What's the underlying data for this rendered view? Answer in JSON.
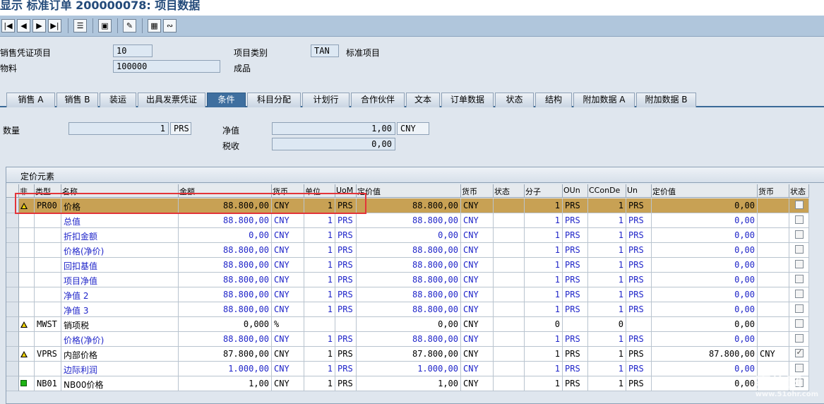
{
  "window": {
    "title": "显示 标准订单 200000078: 项目数据"
  },
  "toolbar": {
    "buttons": [
      "first-icon",
      "prev-icon",
      "next-icon",
      "last-icon",
      "document-flow-icon",
      "overview-icon",
      "edit-icon",
      "calculator-icon",
      "analysis-icon"
    ]
  },
  "header": {
    "item_label": "销售凭证项目",
    "item_value": "10",
    "category_label": "项目类别",
    "category_value": "TAN",
    "category_desc": "标准项目",
    "material_label": "物料",
    "material_value": "100000",
    "material_desc": "成品"
  },
  "tabs": [
    "销售 A",
    "销售 B",
    "装运",
    "出具发票凭证",
    "条件",
    "科目分配",
    "计划行",
    "合作伙伴",
    "文本",
    "订单数据",
    "状态",
    "结构",
    "附加数据 A",
    "附加数据 B"
  ],
  "active_tab": "条件",
  "summary": {
    "qty_label": "数量",
    "qty_value": "1",
    "qty_unit": "PRS",
    "net_label": "净值",
    "net_value": "1,00",
    "net_currency": "CNY",
    "tax_label": "税收",
    "tax_value": "0,00"
  },
  "pricing": {
    "title": "定价元素",
    "columns": [
      "非",
      "类型",
      "名称",
      "金额",
      "货币",
      "单位",
      "UoM",
      "定价值",
      "货币",
      "状态",
      "分子",
      "OUn",
      "CConDe",
      "Un",
      "定价值",
      "货币",
      "状态"
    ],
    "rows": [
      {
        "icon": "yellow",
        "type": "PR00",
        "name": "价格",
        "amount": "88.800,00",
        "curr": "CNY",
        "unit": "1",
        "uom": "PRS",
        "cval": "88.800,00",
        "ccurr": "CNY",
        "stat": "",
        "num": "1",
        "oun": "PRS",
        "ccon": "1",
        "un": "PRS",
        "cval2": "0,00",
        "ccurr2": "",
        "chk": false,
        "blue": false,
        "sel": true
      },
      {
        "icon": "",
        "type": "",
        "name": "总值",
        "amount": "88.800,00",
        "curr": "CNY",
        "unit": "1",
        "uom": "PRS",
        "cval": "88.800,00",
        "ccurr": "CNY",
        "stat": "",
        "num": "1",
        "oun": "PRS",
        "ccon": "1",
        "un": "PRS",
        "cval2": "0,00",
        "ccurr2": "",
        "chk": false,
        "blue": true,
        "sel": false
      },
      {
        "icon": "",
        "type": "",
        "name": "折扣金额",
        "amount": "0,00",
        "curr": "CNY",
        "unit": "1",
        "uom": "PRS",
        "cval": "0,00",
        "ccurr": "CNY",
        "stat": "",
        "num": "1",
        "oun": "PRS",
        "ccon": "1",
        "un": "PRS",
        "cval2": "0,00",
        "ccurr2": "",
        "chk": false,
        "blue": true,
        "sel": false
      },
      {
        "icon": "",
        "type": "",
        "name": "价格(净价)",
        "amount": "88.800,00",
        "curr": "CNY",
        "unit": "1",
        "uom": "PRS",
        "cval": "88.800,00",
        "ccurr": "CNY",
        "stat": "",
        "num": "1",
        "oun": "PRS",
        "ccon": "1",
        "un": "PRS",
        "cval2": "0,00",
        "ccurr2": "",
        "chk": false,
        "blue": true,
        "sel": false
      },
      {
        "icon": "",
        "type": "",
        "name": "回扣基值",
        "amount": "88.800,00",
        "curr": "CNY",
        "unit": "1",
        "uom": "PRS",
        "cval": "88.800,00",
        "ccurr": "CNY",
        "stat": "",
        "num": "1",
        "oun": "PRS",
        "ccon": "1",
        "un": "PRS",
        "cval2": "0,00",
        "ccurr2": "",
        "chk": false,
        "blue": true,
        "sel": false
      },
      {
        "icon": "",
        "type": "",
        "name": "项目净值",
        "amount": "88.800,00",
        "curr": "CNY",
        "unit": "1",
        "uom": "PRS",
        "cval": "88.800,00",
        "ccurr": "CNY",
        "stat": "",
        "num": "1",
        "oun": "PRS",
        "ccon": "1",
        "un": "PRS",
        "cval2": "0,00",
        "ccurr2": "",
        "chk": false,
        "blue": true,
        "sel": false
      },
      {
        "icon": "",
        "type": "",
        "name": "净值 2",
        "amount": "88.800,00",
        "curr": "CNY",
        "unit": "1",
        "uom": "PRS",
        "cval": "88.800,00",
        "ccurr": "CNY",
        "stat": "",
        "num": "1",
        "oun": "PRS",
        "ccon": "1",
        "un": "PRS",
        "cval2": "0,00",
        "ccurr2": "",
        "chk": false,
        "blue": true,
        "sel": false
      },
      {
        "icon": "",
        "type": "",
        "name": "净值 3",
        "amount": "88.800,00",
        "curr": "CNY",
        "unit": "1",
        "uom": "PRS",
        "cval": "88.800,00",
        "ccurr": "CNY",
        "stat": "",
        "num": "1",
        "oun": "PRS",
        "ccon": "1",
        "un": "PRS",
        "cval2": "0,00",
        "ccurr2": "",
        "chk": false,
        "blue": true,
        "sel": false
      },
      {
        "icon": "yellow",
        "type": "MWST",
        "name": "销项税",
        "amount": "0,000",
        "curr": "%",
        "unit": "",
        "uom": "",
        "cval": "0,00",
        "ccurr": "CNY",
        "stat": "",
        "num": "0",
        "oun": "",
        "ccon": "0",
        "un": "",
        "cval2": "0,00",
        "ccurr2": "",
        "chk": false,
        "blue": false,
        "sel": false
      },
      {
        "icon": "",
        "type": "",
        "name": "价格(净价)",
        "amount": "88.800,00",
        "curr": "CNY",
        "unit": "1",
        "uom": "PRS",
        "cval": "88.800,00",
        "ccurr": "CNY",
        "stat": "",
        "num": "1",
        "oun": "PRS",
        "ccon": "1",
        "un": "PRS",
        "cval2": "0,00",
        "ccurr2": "",
        "chk": false,
        "blue": true,
        "sel": false
      },
      {
        "icon": "yellow",
        "type": "VPRS",
        "name": "内部价格",
        "amount": "87.800,00",
        "curr": "CNY",
        "unit": "1",
        "uom": "PRS",
        "cval": "87.800,00",
        "ccurr": "CNY",
        "stat": "",
        "num": "1",
        "oun": "PRS",
        "ccon": "1",
        "un": "PRS",
        "cval2": "87.800,00",
        "ccurr2": "CNY",
        "chk": true,
        "blue": false,
        "sel": false
      },
      {
        "icon": "",
        "type": "",
        "name": "边际利润",
        "amount": "1.000,00",
        "curr": "CNY",
        "unit": "1",
        "uom": "PRS",
        "cval": "1.000,00",
        "ccurr": "CNY",
        "stat": "",
        "num": "1",
        "oun": "PRS",
        "ccon": "1",
        "un": "PRS",
        "cval2": "0,00",
        "ccurr2": "",
        "chk": false,
        "blue": true,
        "sel": false
      },
      {
        "icon": "green",
        "type": "NB01",
        "name": "NB00价格",
        "amount": "1,00",
        "curr": "CNY",
        "unit": "1",
        "uom": "PRS",
        "cval": "1,00",
        "ccurr": "CNY",
        "stat": "",
        "num": "1",
        "oun": "PRS",
        "ccon": "1",
        "un": "PRS",
        "cval2": "0,00",
        "ccurr2": "",
        "chk": false,
        "blue": false,
        "sel": false
      }
    ]
  },
  "watermark": {
    "main": "赛艳网",
    "sub": "www.51ohr.com"
  }
}
